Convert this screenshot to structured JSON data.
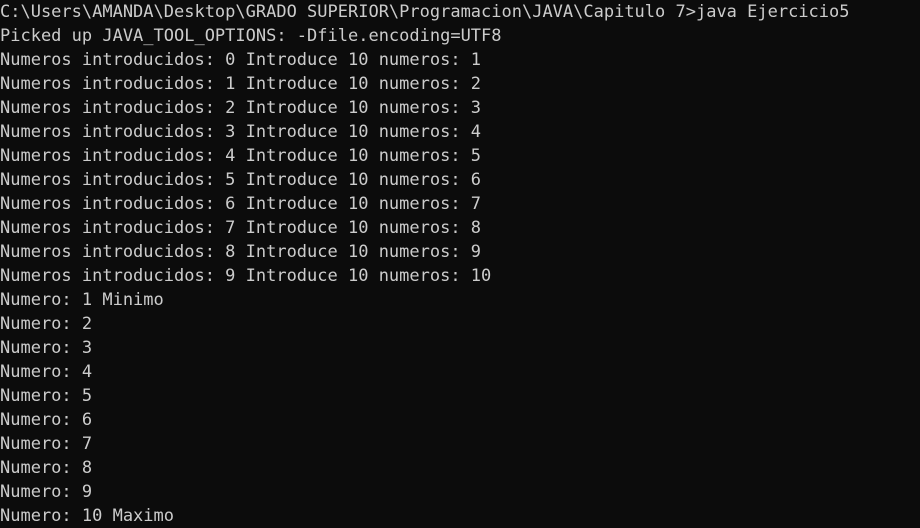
{
  "console": {
    "prompt_line": "C:\\Users\\AMANDA\\Desktop\\GRADO SUPERIOR\\Programacion\\JAVA\\Capitulo 7>java Ejercicio5",
    "lines": [
      "Picked up JAVA_TOOL_OPTIONS: -Dfile.encoding=UTF8",
      "Numeros introducidos: 0 Introduce 10 numeros: 1",
      "Numeros introducidos: 1 Introduce 10 numeros: 2",
      "Numeros introducidos: 2 Introduce 10 numeros: 3",
      "Numeros introducidos: 3 Introduce 10 numeros: 4",
      "Numeros introducidos: 4 Introduce 10 numeros: 5",
      "Numeros introducidos: 5 Introduce 10 numeros: 6",
      "Numeros introducidos: 6 Introduce 10 numeros: 7",
      "Numeros introducidos: 7 Introduce 10 numeros: 8",
      "Numeros introducidos: 8 Introduce 10 numeros: 9",
      "Numeros introducidos: 9 Introduce 10 numeros: 10",
      "Numero: 1 Minimo",
      "Numero: 2",
      "Numero: 3",
      "Numero: 4",
      "Numero: 5",
      "Numero: 6",
      "Numero: 7",
      "Numero: 8",
      "Numero: 9",
      "Numero: 10 Maximo"
    ]
  },
  "colors": {
    "background": "#0c0c0c",
    "text": "#cccccc"
  }
}
